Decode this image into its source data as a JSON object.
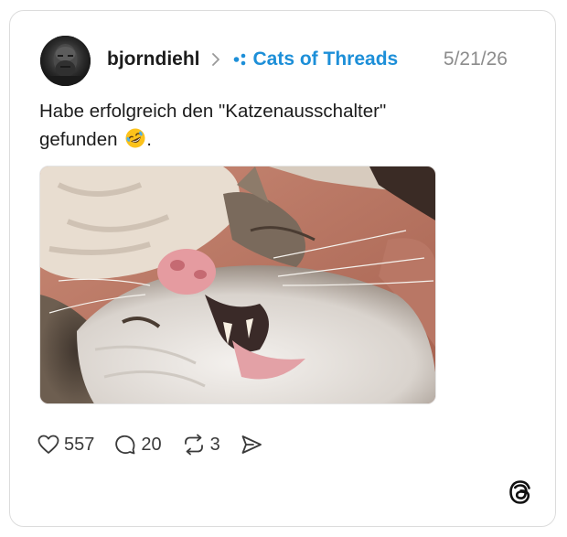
{
  "post": {
    "username": "bjorndiehl",
    "community": "Cats of Threads",
    "date": "5/21/26",
    "text_line1": "Habe erfolgreich den \"Katzenausschalter\"",
    "text_line2": "gefunden",
    "text_suffix": ".",
    "emoji": "rolling-on-floor-laughing-emoji",
    "image": "sleeping-cat-photo"
  },
  "actions": {
    "likes": "557",
    "replies": "20",
    "reposts": "3"
  },
  "colors": {
    "community_blue": "#1d8fd8",
    "date_gray": "#8c8c8c",
    "border": "#dcdcdc"
  },
  "icons": [
    "heart-icon",
    "reply-icon",
    "repost-icon",
    "share-icon",
    "threads-logo-icon",
    "chevron-right-icon",
    "community-icon"
  ]
}
